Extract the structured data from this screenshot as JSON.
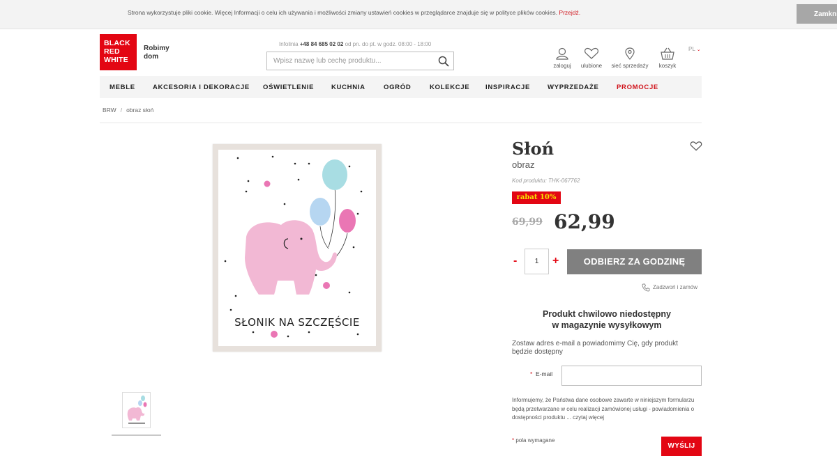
{
  "cookie_bar": {
    "text": "Strona wykorzystuje pliki cookie. Więcej Informacji o celu ich używania i możliwości zmiany ustawień cookies w przeglądarce znajduje się w polityce plików cookies.",
    "link": "Przejdź.",
    "close_label": "Zamknij"
  },
  "header": {
    "logo_lines": [
      "BLACK",
      "RED",
      "WHITE"
    ],
    "tagline": "Robimy dom",
    "infoline_prefix": "Infolinia",
    "infoline_phone": "+48 84 685 02 02",
    "infoline_hours": "od pn. do pt. w godz. 08:00 - 18:00",
    "search_placeholder": "Wpisz nazwę lub cechę produktu...",
    "actions": {
      "login": "zaloguj",
      "favorites": "ulubione",
      "stores": "sieć sprzedaży",
      "cart": "koszyk"
    },
    "language": "PL"
  },
  "nav": {
    "items": [
      "MEBLE",
      "AKCESORIA I DEKORACJE",
      "OŚWIETLENIE",
      "KUCHNIA",
      "OGRÓD",
      "KOLEKCJE",
      "INSPIRACJE",
      "WYPRZEDAŻE",
      "PROMOCJE"
    ]
  },
  "breadcrumb": {
    "items": [
      "BRW",
      "obraz słoń"
    ],
    "separator": "/"
  },
  "product": {
    "title": "Słoń",
    "subtitle": "obraz",
    "code": "Kod produktu: THK-067762",
    "discount_badge": "rabat 10%",
    "old_price": "69,99",
    "new_price": "62,99",
    "image_caption": "SŁONIK NA SZCZĘŚCIE",
    "quantity": "1",
    "qty_minus": "-",
    "qty_plus": "+",
    "pickup_button": "ODBIERZ ZA GODZINĘ",
    "call_order": "Zadzwoń i zamów"
  },
  "availability": {
    "message_line1": "Produkt chwilowo niedostępny",
    "message_line2": "w magazynie wysyłkowym",
    "notify_text": "Zostaw adres e-mail a powiadomimy Cię, gdy produkt będzie dostępny",
    "email_required_mark": "*",
    "email_label": "E-mail",
    "email_value": "",
    "privacy_text": "Informujemy, że Państwa dane osobowe zawarte w niniejszym formularzu będą przetwarzane w celu realizacji zamówionej usługi - powiadomienia o dostępności produktu ... czytaj więcej",
    "required_note": "pola wymagane",
    "send_button": "WYŚLIJ"
  },
  "colors": {
    "brand_red": "#e30613",
    "button_gray": "#808080",
    "badge_text": "#f6e300",
    "elephant_pink": "#f2b8d4"
  },
  "icons": [
    "search-icon",
    "user-icon",
    "heart-icon",
    "location-pin-icon",
    "basket-icon",
    "chevron-down-icon",
    "phone-icon"
  ]
}
